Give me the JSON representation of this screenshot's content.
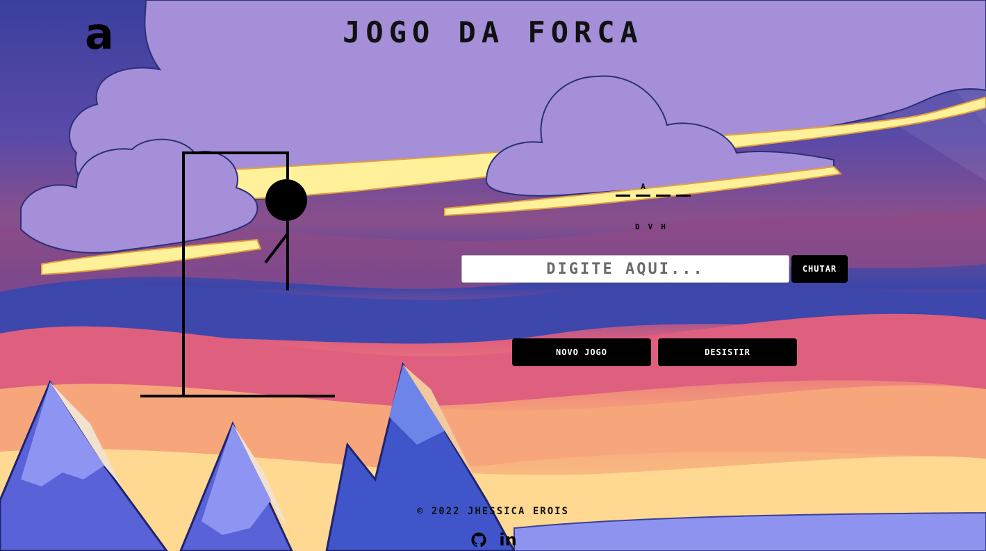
{
  "header": {
    "logo_text": "a",
    "title": "Jogo da Forca"
  },
  "game": {
    "word_slots": [
      "",
      "A",
      "",
      ""
    ],
    "wrong_letters": [
      "D",
      "V",
      "H"
    ],
    "errors_shown": 3,
    "errors_max": 6
  },
  "form": {
    "placeholder": "Digite aqui...",
    "guess_button": "Chutar"
  },
  "actions": {
    "new_game": "Novo Jogo",
    "give_up": "Desistir"
  },
  "footer": {
    "copyright": "© 2022 Jhessica Erois",
    "socials": [
      {
        "icon": "github-icon"
      },
      {
        "icon": "linkedin-icon",
        "glyph": "in"
      }
    ]
  }
}
